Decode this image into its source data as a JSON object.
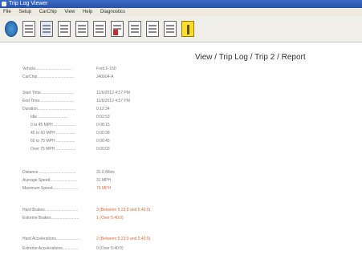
{
  "window": {
    "title": "Trip Log Viewer"
  },
  "menu": [
    "File",
    "Setup",
    "CarChip",
    "View",
    "Help",
    "Diagnostics"
  ],
  "toolbar": [
    {
      "name": "home-icon"
    },
    {
      "name": "document-icon"
    },
    {
      "name": "document-icon"
    },
    {
      "name": "document-icon"
    },
    {
      "name": "document-icon"
    },
    {
      "name": "document-icon"
    },
    {
      "name": "alert-icon"
    },
    {
      "name": "document-icon"
    },
    {
      "name": "save-icon"
    },
    {
      "name": "document-icon"
    },
    {
      "name": "warning-icon"
    }
  ],
  "report": {
    "breadcrumb": "View / Trip Log / Trip 2 / Report",
    "rows": [
      {
        "label": "Vehicle.................................",
        "value": "Ford F-150",
        "red": false,
        "indent": false
      },
      {
        "label": "CarChip.................................",
        "value": "J40004-A",
        "red": false,
        "indent": false
      },
      {
        "label": "Start Time..............................",
        "value": "11/6/2012 4:57 PM",
        "red": false,
        "indent": false
      },
      {
        "label": "End Time...............................",
        "value": "11/6/2012 4:57 PM",
        "red": false,
        "indent": false
      },
      {
        "label": "Duration..................................",
        "value": "0:12:34",
        "red": false,
        "indent": false
      },
      {
        "label": "Idle ...........................",
        "value": "0:02:53",
        "red": false,
        "indent": true
      },
      {
        "label": "0 to 45 MPH ...................",
        "value": "0:08:15",
        "red": false,
        "indent": true
      },
      {
        "label": "45 to 60 MPH .................",
        "value": "0:00:38",
        "red": false,
        "indent": true
      },
      {
        "label": "60 to 75 MPH .................",
        "value": "0:00:45",
        "red": false,
        "indent": true
      },
      {
        "label": "Over 75 MPH ..................",
        "value": "0:00:03",
        "red": false,
        "indent": true
      },
      {
        "label": "Distance..................................",
        "value": "31.0 Miles",
        "red": false,
        "indent": false
      },
      {
        "label": "Average Speed........................",
        "value": "31 MPH",
        "red": false,
        "indent": false
      },
      {
        "label": "Maximum Speed.......................",
        "value": "76 MPH",
        "red": true,
        "indent": false
      },
      {
        "label": "Hard Brakes..............................",
        "value": "3 (Between 5:23:0 and 5:40:0)",
        "red": true,
        "indent": false
      },
      {
        "label": "Extreme Brakes.........................",
        "value": "1 (Over 5:40:0)",
        "red": true,
        "indent": false
      },
      {
        "label": "Hard Accelerations.....................",
        "value": "2 (Between 5:23:0 and 5:40:0)",
        "red": true,
        "indent": false
      },
      {
        "label": "Extreme Accelerations..............",
        "value": "0 (Over 5:40:0)",
        "red": false,
        "indent": false
      }
    ]
  }
}
